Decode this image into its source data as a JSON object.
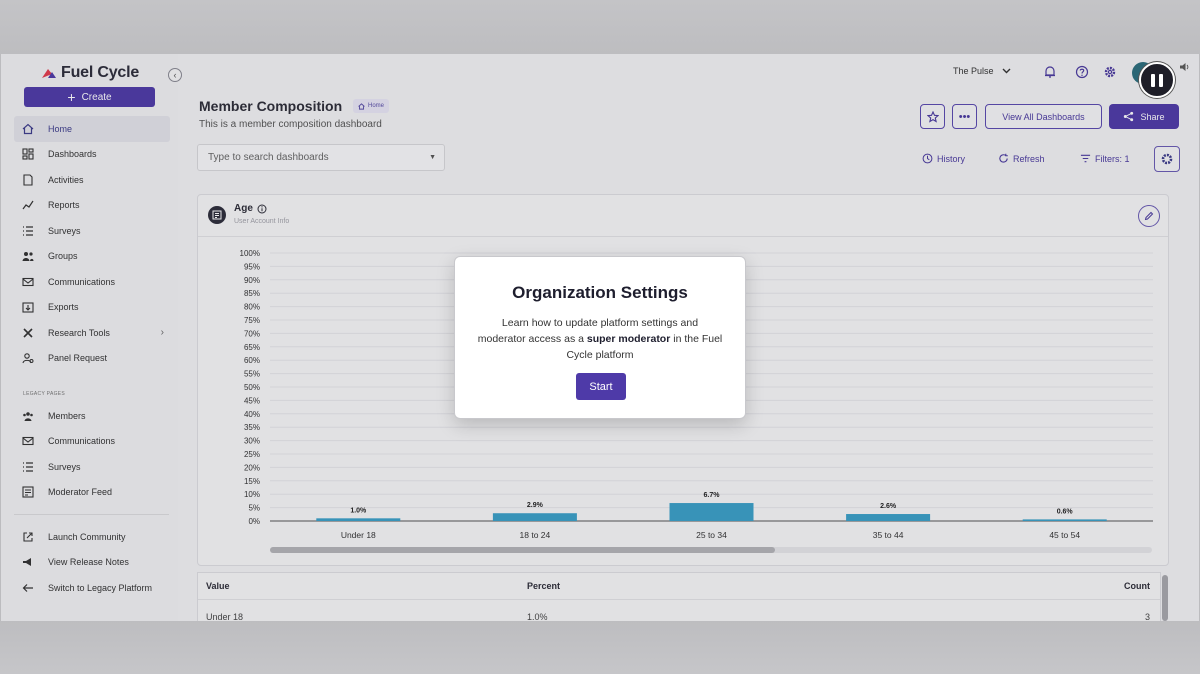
{
  "brand": {
    "name": "Fuel Cycle",
    "accent": "#4e3aa8"
  },
  "sidebar": {
    "create_label": "Create",
    "items": [
      {
        "label": "Home",
        "icon": "home-icon",
        "active": true
      },
      {
        "label": "Dashboards",
        "icon": "dashboards-icon"
      },
      {
        "label": "Activities",
        "icon": "activities-icon"
      },
      {
        "label": "Reports",
        "icon": "reports-icon"
      },
      {
        "label": "Surveys",
        "icon": "surveys-icon"
      },
      {
        "label": "Groups",
        "icon": "groups-icon"
      },
      {
        "label": "Communications",
        "icon": "mail-icon"
      },
      {
        "label": "Exports",
        "icon": "exports-icon"
      },
      {
        "label": "Research Tools",
        "icon": "tools-icon",
        "has_submenu": true
      },
      {
        "label": "Panel Request",
        "icon": "panel-request-icon"
      }
    ],
    "legacy_label": "LEGACY PAGES",
    "legacy_items": [
      {
        "label": "Members",
        "icon": "members-icon"
      },
      {
        "label": "Communications",
        "icon": "mail-icon"
      },
      {
        "label": "Surveys",
        "icon": "surveys-icon"
      },
      {
        "label": "Moderator Feed",
        "icon": "feed-icon"
      }
    ],
    "footer_items": [
      {
        "label": "Launch Community",
        "icon": "external-link-icon"
      },
      {
        "label": "View Release Notes",
        "icon": "megaphone-icon"
      },
      {
        "label": "Switch to Legacy Platform",
        "icon": "arrow-left-icon"
      }
    ]
  },
  "header": {
    "org_name": "The Pulse",
    "title": "Member Composition",
    "breadcrumb": "Home",
    "subtitle": "This is a member composition dashboard",
    "view_all_label": "View All Dashboards",
    "share_label": "Share"
  },
  "toolbar": {
    "search_placeholder": "Type to search dashboards",
    "history_label": "History",
    "refresh_label": "Refresh",
    "filters_label": "Filters: 1"
  },
  "card": {
    "title": "Age",
    "subtitle": "User Account Info"
  },
  "chart_data": {
    "type": "bar",
    "title": "Age",
    "categories": [
      "Under 18",
      "18 to 24",
      "25 to 34",
      "35 to 44",
      "45 to 54"
    ],
    "values": [
      1.0,
      2.9,
      6.7,
      2.6,
      0.6
    ],
    "value_labels": [
      "1.0%",
      "2.9%",
      "6.7%",
      "2.6%",
      "0.6%"
    ],
    "ylim": [
      0,
      100
    ],
    "y_ticks": [
      "0%",
      "5%",
      "10%",
      "15%",
      "20%",
      "25%",
      "30%",
      "35%",
      "40%",
      "45%",
      "50%",
      "55%",
      "60%",
      "65%",
      "70%",
      "75%",
      "80%",
      "85%",
      "90%",
      "95%",
      "100%"
    ],
    "bar_color": "#3aa0c8",
    "grid": true
  },
  "table": {
    "headers": [
      "Value",
      "Percent",
      "Count"
    ],
    "rows": [
      [
        "Under 18",
        "1.0%",
        "3"
      ]
    ]
  },
  "modal": {
    "title": "Organization Settings",
    "text_before": "Learn how to update platform settings and moderator access as a ",
    "text_bold": "super moderator",
    "text_after": " in the Fuel Cycle platform",
    "start_label": "Start"
  }
}
